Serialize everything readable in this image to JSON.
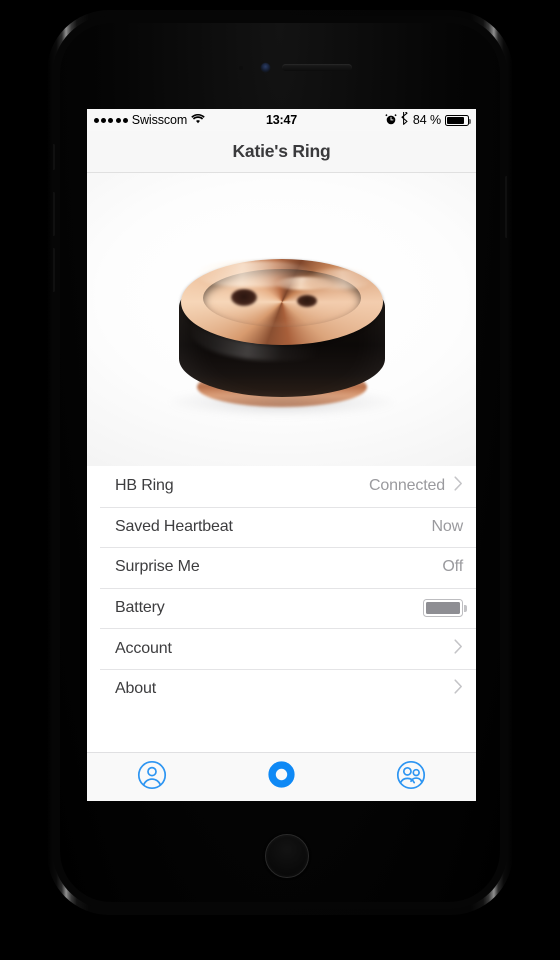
{
  "device": {
    "name": "iphone-black",
    "hardware": {
      "earpiece": "speaker-grille",
      "front_camera": "front-camera-lens",
      "proximity_sensor": "proximity-sensor",
      "home_button": "home-button",
      "silent_switch": "silent-switch",
      "volume_up": "volume-up-button",
      "volume_down": "volume-down-button",
      "power": "power-button"
    }
  },
  "colors": {
    "accent_blue": "#2d95f2",
    "nav_background": "#f7f7f7",
    "statusbar_background": "#f8f8f8",
    "tabbar_background": "#f9f9f9",
    "label_text": "#3d3d3f",
    "value_text": "#9a9a9e",
    "separator": "#e4e4e6",
    "battery_fill": "#8e8e93",
    "ring_black": "#110d0b",
    "ring_rose_gold": "#c7845a"
  },
  "status_bar": {
    "signal_dots": 5,
    "signal_filled": 5,
    "carrier": "Swisscom",
    "wifi_icon": "wifi-icon",
    "time": "13:47",
    "alarm_icon": "alarm-clock-icon",
    "bluetooth_icon": "bluetooth-icon",
    "battery_percent": "84 %",
    "battery_level": 84
  },
  "nav_bar": {
    "title": "Katie's Ring"
  },
  "hero": {
    "product_image_name": "hb-ring-product-photo",
    "alt": "Black smart ring with rose gold interior"
  },
  "settings_list": {
    "rows": [
      {
        "label": "HB Ring",
        "value": "Connected",
        "accessory": "chevron",
        "name": "row-hb-ring"
      },
      {
        "label": "Saved Heartbeat",
        "value": "Now",
        "accessory": "none",
        "name": "row-saved-heartbeat"
      },
      {
        "label": "Surprise Me",
        "value": "Off",
        "accessory": "none",
        "name": "row-surprise-me"
      },
      {
        "label": "Battery",
        "value": "",
        "accessory": "battery",
        "name": "row-battery",
        "battery_level": 100
      },
      {
        "label": "Account",
        "value": "",
        "accessory": "chevron",
        "name": "row-account"
      },
      {
        "label": "About",
        "value": "",
        "accessory": "chevron",
        "name": "row-about"
      }
    ]
  },
  "tab_bar": {
    "items": [
      {
        "icon": "person-circle-icon",
        "name": "tab-profile",
        "active": false
      },
      {
        "icon": "ring-circle-icon",
        "name": "tab-ring",
        "active": true
      },
      {
        "icon": "people-circle-icon",
        "name": "tab-friends",
        "active": false
      }
    ]
  }
}
